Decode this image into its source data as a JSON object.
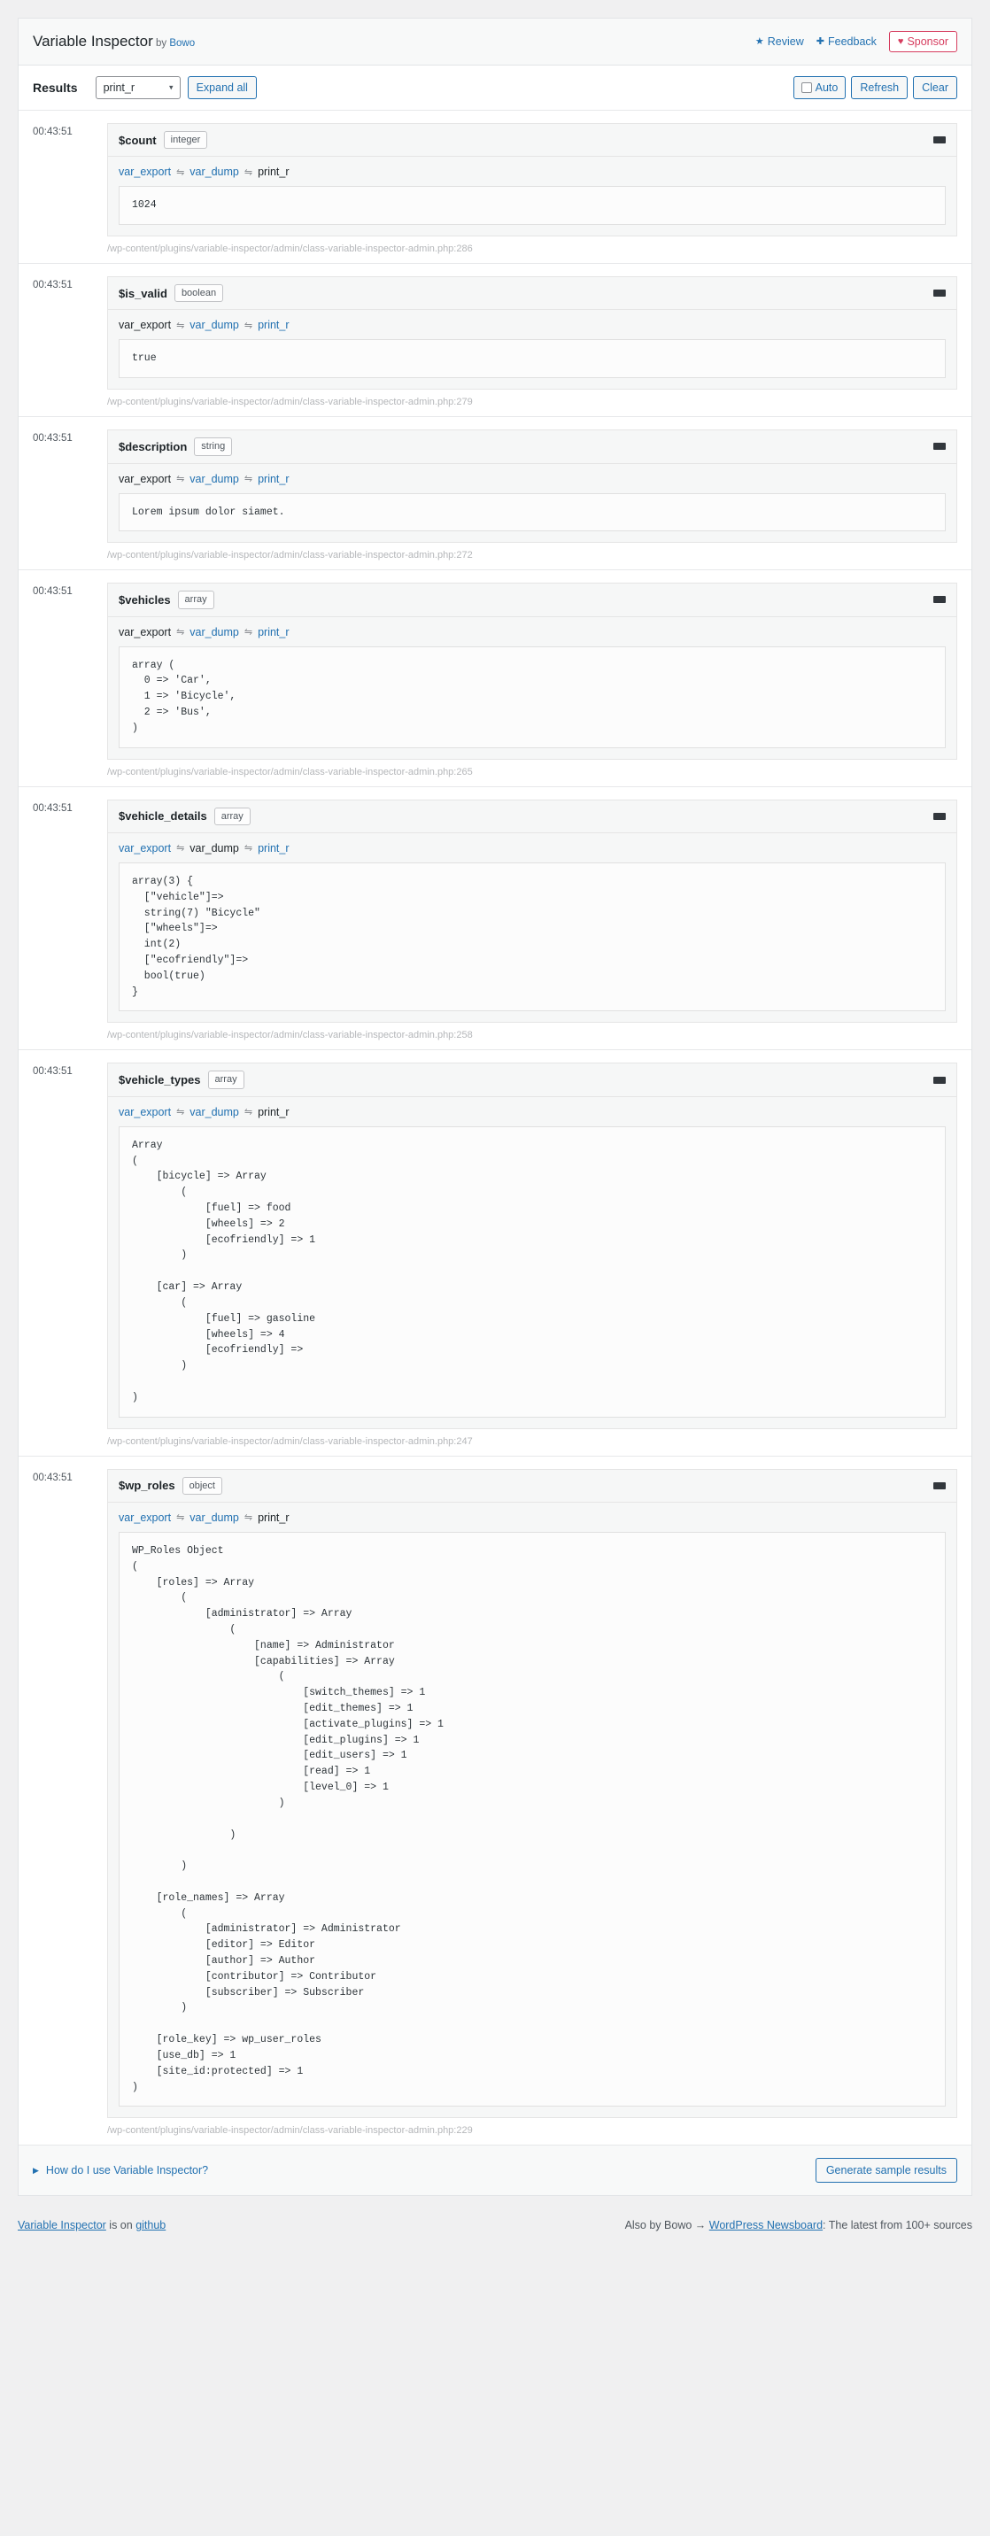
{
  "header": {
    "title": "Variable Inspector",
    "by_label": "by",
    "author": "Bowo",
    "review_label": "Review",
    "review_icon": "star-icon",
    "feedback_label": "Feedback",
    "feedback_icon": "plus-icon",
    "sponsor_label": "Sponsor",
    "sponsor_icon": "heart-icon",
    "sponsor_color": "#d63c5e",
    "accent_color": "#2271b1"
  },
  "toolbar": {
    "results_label": "Results",
    "mode_selected": "print_r",
    "mode_options": [
      "var_export",
      "var_dump",
      "print_r"
    ],
    "expand_all_label": "Expand all",
    "auto_label": "Auto",
    "auto_checked": false,
    "refresh_label": "Refresh",
    "clear_label": "Clear"
  },
  "functions": [
    "var_export",
    "var_dump",
    "print_r"
  ],
  "results": [
    {
      "time": "00:43:51",
      "name": "$count",
      "type": "integer",
      "active_fn": "print_r",
      "output": "1024",
      "path": "/wp-content/plugins/variable-inspector/admin/class-variable-inspector-admin.php:286"
    },
    {
      "time": "00:43:51",
      "name": "$is_valid",
      "type": "boolean",
      "active_fn": "var_export",
      "output": "true",
      "path": "/wp-content/plugins/variable-inspector/admin/class-variable-inspector-admin.php:279"
    },
    {
      "time": "00:43:51",
      "name": "$description",
      "type": "string",
      "active_fn": "var_export",
      "output": "Lorem ipsum dolor siamet.",
      "path": "/wp-content/plugins/variable-inspector/admin/class-variable-inspector-admin.php:272"
    },
    {
      "time": "00:43:51",
      "name": "$vehicles",
      "type": "array",
      "active_fn": "var_export",
      "output": "array (\n  0 => 'Car',\n  1 => 'Bicycle',\n  2 => 'Bus',\n)",
      "path": "/wp-content/plugins/variable-inspector/admin/class-variable-inspector-admin.php:265"
    },
    {
      "time": "00:43:51",
      "name": "$vehicle_details",
      "type": "array",
      "active_fn": "var_dump",
      "output": "array(3) {\n  [\"vehicle\"]=>\n  string(7) \"Bicycle\"\n  [\"wheels\"]=>\n  int(2)\n  [\"ecofriendly\"]=>\n  bool(true)\n}",
      "path": "/wp-content/plugins/variable-inspector/admin/class-variable-inspector-admin.php:258"
    },
    {
      "time": "00:43:51",
      "name": "$vehicle_types",
      "type": "array",
      "active_fn": "print_r",
      "output": "Array\n(\n    [bicycle] => Array\n        (\n            [fuel] => food\n            [wheels] => 2\n            [ecofriendly] => 1\n        )\n\n    [car] => Array\n        (\n            [fuel] => gasoline\n            [wheels] => 4\n            [ecofriendly] => \n        )\n\n)",
      "path": "/wp-content/plugins/variable-inspector/admin/class-variable-inspector-admin.php:247"
    },
    {
      "time": "00:43:51",
      "name": "$wp_roles",
      "type": "object",
      "active_fn": "print_r",
      "output": "WP_Roles Object\n(\n    [roles] => Array\n        (\n            [administrator] => Array\n                (\n                    [name] => Administrator\n                    [capabilities] => Array\n                        (\n                            [switch_themes] => 1\n                            [edit_themes] => 1\n                            [activate_plugins] => 1\n                            [edit_plugins] => 1\n                            [edit_users] => 1\n                            [read] => 1\n                            [level_0] => 1\n                        )\n\n                )\n\n        )\n\n    [role_names] => Array\n        (\n            [administrator] => Administrator\n            [editor] => Editor\n            [author] => Author\n            [contributor] => Contributor\n            [subscriber] => Subscriber\n        )\n\n    [role_key] => wp_user_roles\n    [use_db] => 1\n    [site_id:protected] => 1\n)",
      "path": "/wp-content/plugins/variable-inspector/admin/class-variable-inspector-admin.php:229"
    }
  ],
  "panel_footer": {
    "howto_label": "How do I use Variable Inspector?",
    "howto_icon": "triangle-right-icon",
    "generate_label": "Generate sample results"
  },
  "page_footer": {
    "left_link_1": "Variable Inspector",
    "left_mid": " is on ",
    "left_link_2": "github",
    "right_prefix": "Also by Bowo → ",
    "right_link": "WordPress Newsboard",
    "right_suffix": ": The latest from 100+ sources"
  }
}
